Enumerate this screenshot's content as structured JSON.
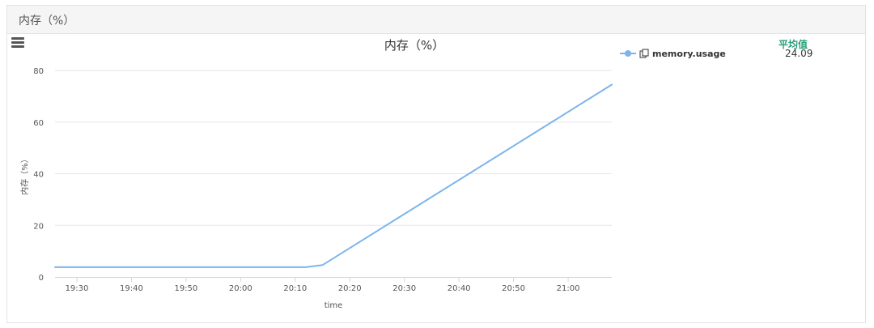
{
  "panel": {
    "title": "内存（%）"
  },
  "legend": {
    "avg_header": "平均值",
    "items": [
      {
        "name": "memory.usage",
        "avg": "24.09",
        "color": "#7cb5ec"
      }
    ]
  },
  "chart_data": {
    "type": "line",
    "title": "内存（%）",
    "xlabel": "time",
    "ylabel": "内存（%）",
    "x_ticks": [
      "19:30",
      "19:40",
      "19:50",
      "20:00",
      "20:10",
      "20:20",
      "20:30",
      "20:40",
      "20:50",
      "21:00"
    ],
    "y_ticks": [
      0,
      20,
      40,
      60,
      80
    ],
    "ylim": [
      0,
      80
    ],
    "xlim": [
      "19:26",
      "21:08"
    ],
    "grid": true,
    "legend_position": "right",
    "series": [
      {
        "name": "memory.usage",
        "color": "#7cb5ec",
        "x": [
          "19:26",
          "20:10",
          "20:12",
          "20:15",
          "21:08"
        ],
        "y": [
          3.8,
          3.8,
          3.8,
          4.6,
          74.5
        ]
      }
    ]
  }
}
